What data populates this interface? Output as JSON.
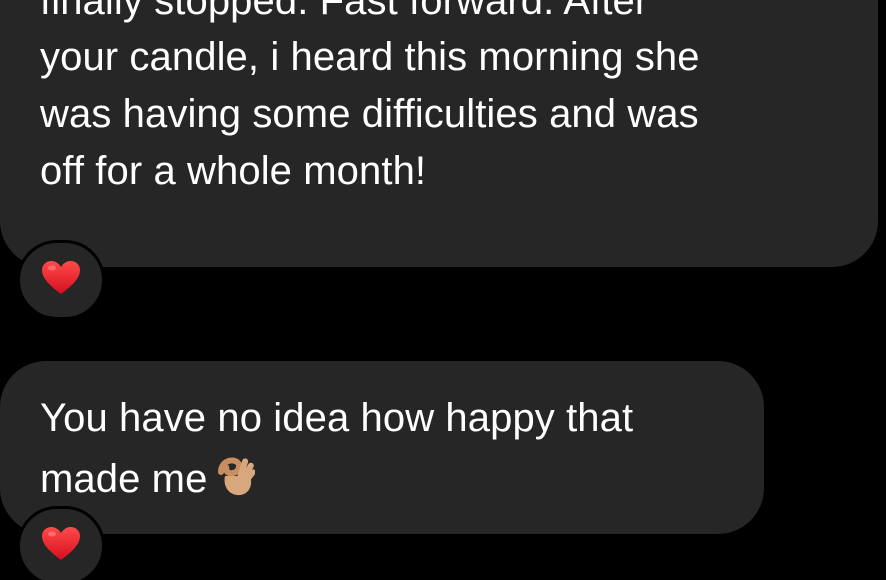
{
  "messages": [
    {
      "lines": [
        "finally stopped. Fast forward. After",
        "your candle, i heard this morning she",
        "was having some difficulties and was",
        "off for a whole month!"
      ],
      "reaction": "red-heart-icon"
    },
    {
      "lines": [
        "You have no idea how happy that",
        "made me"
      ],
      "trailing_emoji": "ok-hand-icon",
      "reaction": "red-heart-icon"
    }
  ],
  "colors": {
    "background": "#000000",
    "bubble": "#262626",
    "text": "#ffffff",
    "heart": "#e8192c",
    "skin": "#d9a77c"
  }
}
